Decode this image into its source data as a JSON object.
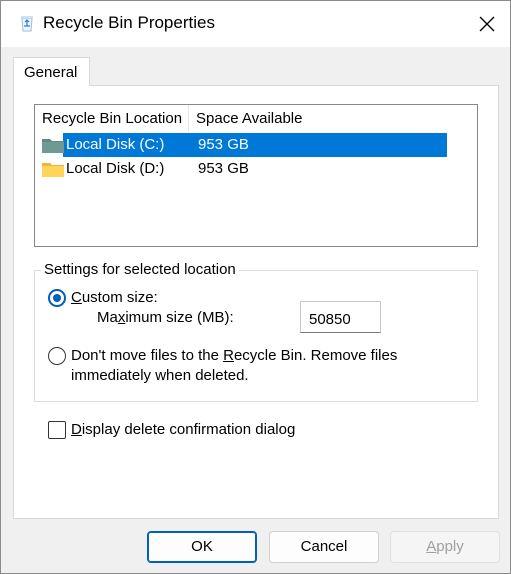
{
  "window": {
    "title": "Recycle Bin Properties",
    "close_icon": "close-icon"
  },
  "tabs": [
    {
      "label": "General",
      "selected": true
    }
  ],
  "listview": {
    "columns": [
      "Recycle Bin Location",
      "Space Available"
    ],
    "rows": [
      {
        "name": "Local Disk (C:)",
        "space": "953 GB",
        "selected": true,
        "icon": "folder-teal-icon"
      },
      {
        "name": "Local Disk (D:)",
        "space": "953 GB",
        "selected": false,
        "icon": "folder-yellow-icon"
      }
    ]
  },
  "settings": {
    "group_label": "Settings for selected location",
    "custom_size": {
      "label": "Custom size:",
      "checked": true
    },
    "max_size_label": "Maximum size (MB):",
    "max_size_value": "50850",
    "no_bin": {
      "label_line1": "Don't move files to the Recycle Bin. Remove files",
      "label_line2": "immediately when deleted.",
      "checked": false
    }
  },
  "confirm_dialog": {
    "label": "Display delete confirmation dialog",
    "checked": false
  },
  "buttons": {
    "ok": "OK",
    "cancel": "Cancel",
    "apply": "Apply"
  },
  "colors": {
    "accent": "#005fb8",
    "selection": "#0078d7"
  }
}
